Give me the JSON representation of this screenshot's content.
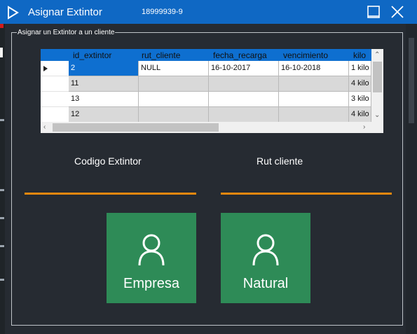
{
  "window": {
    "title": "Asignar Extintor",
    "subtitle": "18999939-9"
  },
  "groupbox": {
    "legend": "Asignar un Extintor a un cliente"
  },
  "grid": {
    "columns": [
      "id_extintor",
      "rut_cliente",
      "fecha_recarga",
      "vencimiento",
      "kilo"
    ],
    "rows": [
      [
        "2",
        "NULL",
        "16-10-2017",
        "16-10-2018",
        "1 kilo"
      ],
      [
        "11",
        "",
        "",
        "",
        "4 kilo"
      ],
      [
        "13",
        "",
        "",
        "",
        "3 kilo"
      ],
      [
        "12",
        "",
        "",
        "",
        "4 kilo"
      ]
    ]
  },
  "form": {
    "codigo_label": "Codigo Extintor",
    "rut_label": "Rut cliente"
  },
  "buttons": {
    "empresa": "Empresa",
    "natural": "Natural"
  },
  "colors": {
    "titlebar": "#0f68c4",
    "accent_underline": "#e8880f",
    "tile": "#2e8b57"
  }
}
